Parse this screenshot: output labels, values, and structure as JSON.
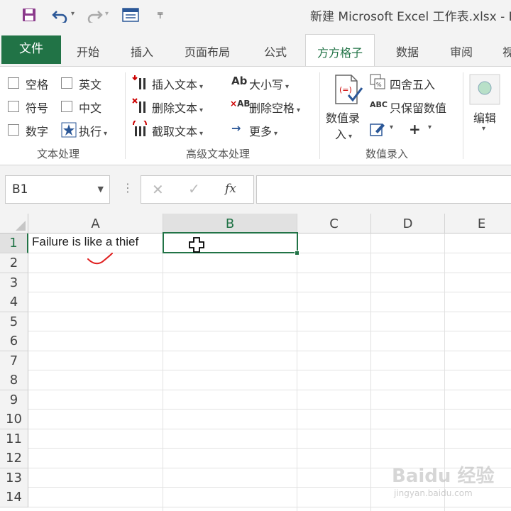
{
  "window": {
    "title": "新建 Microsoft Excel 工作表.xlsx - E"
  },
  "tabs": {
    "file": "文件",
    "items": [
      "开始",
      "插入",
      "页面布局",
      "公式",
      "方方格子",
      "数据",
      "审阅",
      "视"
    ],
    "active_index": 4
  },
  "ribbon": {
    "text_group": {
      "checkboxes": [
        "空格",
        "英文",
        "符号",
        "中文",
        "数字"
      ],
      "execute": "执行",
      "label": "文本处理"
    },
    "advanced_group": {
      "insert_text": "插入文本",
      "delete_text": "删除文本",
      "extract_text": "截取文本",
      "case": "大小写",
      "delete_spaces": "删除空格",
      "more": "更多",
      "label": "高级文本处理"
    },
    "numeric_group": {
      "entry_line1": "数值录",
      "entry_line2": "入",
      "round": "四舍五入",
      "keep_values": "只保留数值",
      "plus": "+",
      "label": "数值录入"
    },
    "edit": "编辑"
  },
  "formula_bar": {
    "name_box": "B1",
    "fx": "fx",
    "formula": ""
  },
  "sheet": {
    "columns": [
      "A",
      "B",
      "C",
      "D",
      "E"
    ],
    "rows": [
      "1",
      "2",
      "3",
      "4",
      "5",
      "6",
      "7",
      "8",
      "9",
      "10",
      "11",
      "12",
      "13",
      "14"
    ],
    "selected_column": "B",
    "selected_row": "1",
    "cells": {
      "A1": "Failure is like a thief"
    }
  },
  "watermark": {
    "brand": "Baidu 经验",
    "url": "jingyan.baidu.com"
  },
  "colors": {
    "accent": "#217346",
    "annotation": "#e02020"
  }
}
